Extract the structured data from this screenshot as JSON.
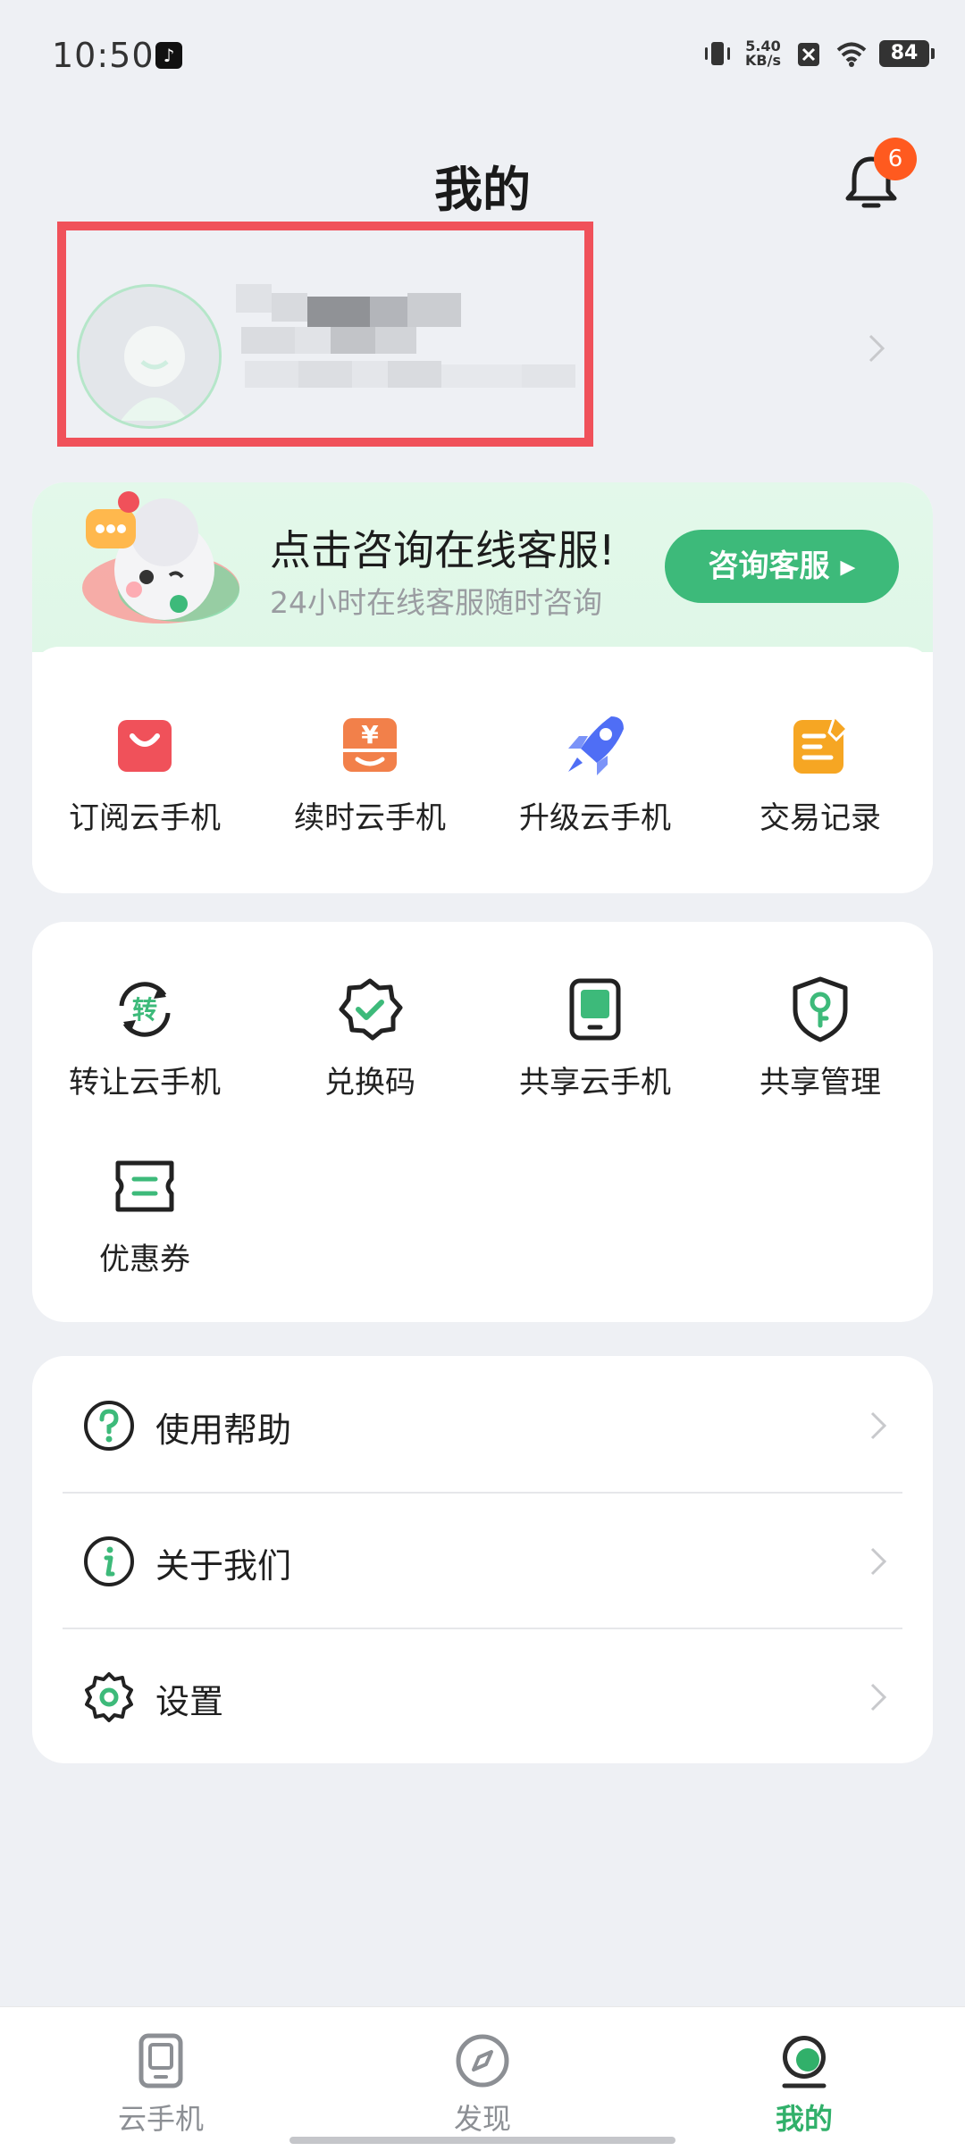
{
  "status_bar": {
    "time": "10:50",
    "net_speed_value": "5.40",
    "net_speed_unit": "KB/s",
    "battery": "84"
  },
  "header": {
    "title": "我的",
    "notification_count": "6"
  },
  "consult": {
    "title": "点击咨询在线客服!",
    "subtitle": "24小时在线客服随时咨询",
    "button_label": "咨询客服 ▸"
  },
  "actions": [
    {
      "label": "订阅云手机",
      "icon": "shopping-bag-icon",
      "color": "#f0515a"
    },
    {
      "label": "续时云手机",
      "icon": "yuan-renew-icon",
      "color": "#f2804a"
    },
    {
      "label": "升级云手机",
      "icon": "rocket-icon",
      "color": "#4f6ef5"
    },
    {
      "label": "交易记录",
      "icon": "note-edit-icon",
      "color": "#f6a623"
    }
  ],
  "tools": [
    {
      "label": "转让云手机",
      "icon": "transfer-icon"
    },
    {
      "label": "兑换码",
      "icon": "redeem-badge-icon"
    },
    {
      "label": "共享云手机",
      "icon": "tablet-share-icon"
    },
    {
      "label": "共享管理",
      "icon": "shield-key-icon"
    },
    {
      "label": "优惠券",
      "icon": "coupon-icon"
    }
  ],
  "menu": [
    {
      "label": "使用帮助",
      "icon": "question-circle-icon"
    },
    {
      "label": "关于我们",
      "icon": "info-circle-icon"
    },
    {
      "label": "设置",
      "icon": "gear-icon"
    }
  ],
  "bottom_nav": [
    {
      "label": "云手机",
      "icon": "phone-icon",
      "active": false
    },
    {
      "label": "发现",
      "icon": "compass-icon",
      "active": false
    },
    {
      "label": "我的",
      "icon": "profile-icon",
      "active": true
    }
  ],
  "colors": {
    "accent": "#3dba7a",
    "highlight_border": "#f0515a",
    "badge": "#ff5a1f",
    "background": "#eef0f4"
  }
}
